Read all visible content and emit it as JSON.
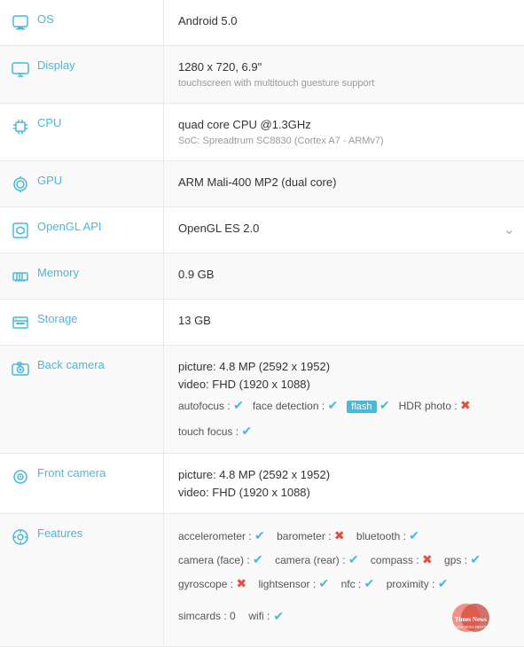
{
  "rows": [
    {
      "id": "os",
      "label": "OS",
      "icon": "os",
      "value_main": "Android 5.0",
      "value_sub": "",
      "type": "simple"
    },
    {
      "id": "display",
      "label": "Display",
      "icon": "display",
      "value_main": "1280 x 720, 6.9\"",
      "value_sub": "touchscreen with multitouch guesture support",
      "type": "simple"
    },
    {
      "id": "cpu",
      "label": "CPU",
      "icon": "cpu",
      "value_main": "quad core CPU @1.3GHz",
      "value_sub": "SoC: Spreadtrum SC8830 (Cortex A7 - ARMv7)",
      "type": "simple"
    },
    {
      "id": "gpu",
      "label": "GPU",
      "icon": "gpu",
      "value_main": "ARM Mali-400 MP2 (dual core)",
      "value_sub": "",
      "type": "simple"
    },
    {
      "id": "opengl",
      "label": "OpenGL API",
      "icon": "opengl",
      "value_main": "OpenGL ES 2.0",
      "value_sub": "",
      "type": "dropdown"
    },
    {
      "id": "memory",
      "label": "Memory",
      "icon": "memory",
      "value_main": "0.9 GB",
      "value_sub": "",
      "type": "simple"
    },
    {
      "id": "storage",
      "label": "Storage",
      "icon": "storage",
      "value_main": "13 GB",
      "value_sub": "",
      "type": "simple"
    },
    {
      "id": "back-camera",
      "label": "Back camera",
      "icon": "camera",
      "type": "backcamera"
    },
    {
      "id": "front-camera",
      "label": "Front camera",
      "icon": "frontcamera",
      "type": "frontcamera"
    },
    {
      "id": "features",
      "label": "Features",
      "icon": "features",
      "type": "features"
    }
  ],
  "back_camera": {
    "picture": "picture: 4.8 MP (2592 x 1952)",
    "video": "video: FHD (1920 x 1088)",
    "autofocus_label": "autofocus :",
    "autofocus": true,
    "face_detection_label": "face detection :",
    "face_detection": true,
    "flash_label": "flash",
    "flash": true,
    "hdr_label": "HDR photo :",
    "hdr": false,
    "touch_focus_label": "touch focus :",
    "touch_focus": true
  },
  "front_camera": {
    "picture": "picture: 4.8 MP (2592 x 1952)",
    "video": "video: FHD (1920 x 1088)"
  },
  "features": {
    "line1": [
      {
        "label": "accelerometer :",
        "val": true
      },
      {
        "label": "barometer :",
        "val": false
      },
      {
        "label": "bluetooth :",
        "val": true
      }
    ],
    "line2": [
      {
        "label": "camera (face) :",
        "val": true
      },
      {
        "label": "camera (rear) :",
        "val": true
      },
      {
        "label": "compass :",
        "val": false
      },
      {
        "label": "gps :",
        "val": true
      }
    ],
    "line3": [
      {
        "label": "gyroscope :",
        "val": false
      },
      {
        "label": "lightsensor :",
        "val": true
      },
      {
        "label": "nfc :",
        "val": true
      },
      {
        "label": "proximity :",
        "val": true
      }
    ],
    "line4": [
      {
        "label": "simcards :",
        "val_text": "0"
      },
      {
        "label": "wifi :",
        "val": true
      }
    ]
  },
  "accent_color": "#4ab8d8"
}
